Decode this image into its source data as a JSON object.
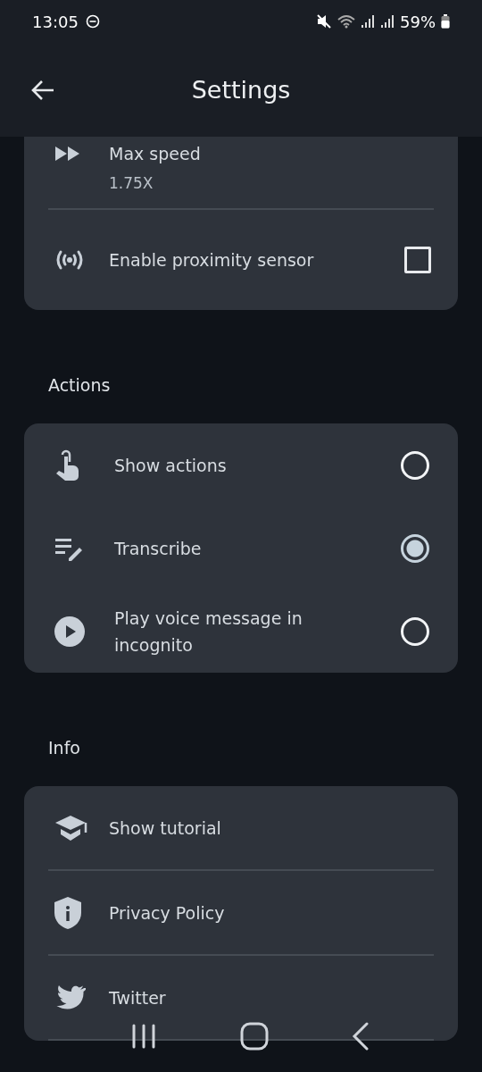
{
  "status_bar": {
    "time": "13:05",
    "battery": "59%"
  },
  "header": {
    "title": "Settings"
  },
  "sections": [
    {
      "items": [
        {
          "kind": "value",
          "title": "Max speed",
          "value": "1.75X"
        },
        {
          "kind": "checkbox",
          "title": "Enable proximity sensor",
          "checked": false
        }
      ]
    },
    {
      "heading": "Actions",
      "items": [
        {
          "kind": "radio",
          "title": "Show actions",
          "selected": false
        },
        {
          "kind": "radio",
          "title": "Transcribe",
          "selected": true
        },
        {
          "kind": "radio",
          "title": "Play voice message in incognito",
          "selected": false
        }
      ]
    },
    {
      "heading": "Info",
      "items": [
        {
          "kind": "link",
          "title": "Show tutorial"
        },
        {
          "kind": "link",
          "title": "Privacy Policy"
        },
        {
          "kind": "link",
          "title": "Twitter"
        }
      ]
    }
  ]
}
